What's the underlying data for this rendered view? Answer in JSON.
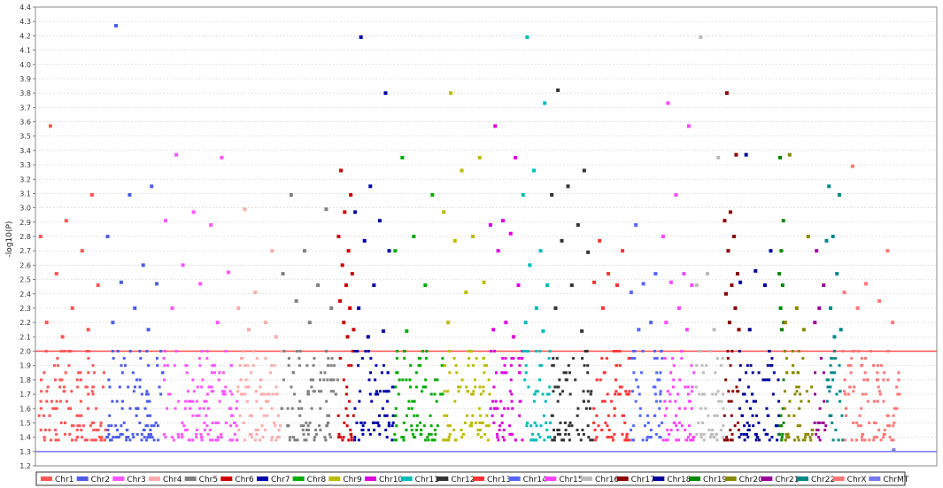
{
  "chart_data": {
    "type": "scatter",
    "title": "",
    "xlabel": "",
    "ylabel": "-log10(P)",
    "ylim": [
      1.2,
      4.4
    ],
    "yticks": [
      1.2,
      1.3,
      1.4,
      1.5,
      1.6,
      1.7,
      1.8,
      1.9,
      2.0,
      2.1,
      2.2,
      2.3,
      2.4,
      2.5,
      2.6,
      2.7,
      2.8,
      2.9,
      3.0,
      3.1,
      3.2,
      3.3,
      3.4,
      3.5,
      3.6,
      3.7,
      3.8,
      3.9,
      4.0,
      4.1,
      4.2,
      4.3,
      4.4
    ],
    "grid": true,
    "legend_position": "bottom",
    "threshold_lines": [
      {
        "value": 2.0,
        "color": "#ff4c4c"
      },
      {
        "value": 1.3,
        "color": "#6a6aff"
      }
    ],
    "series": [
      {
        "name": "Chr1",
        "color": "#ff5555",
        "top": [
          3.57,
          3.09,
          2.91,
          2.8,
          2.7,
          2.54,
          2.46,
          2.3,
          2.2,
          2.15,
          2.1
        ]
      },
      {
        "name": "Chr2",
        "color": "#4c5ce6",
        "top": [
          4.27,
          3.15,
          3.09,
          2.8,
          2.6,
          2.48,
          2.47,
          2.3,
          2.2,
          2.15
        ]
      },
      {
        "name": "Chr3",
        "color": "#ff55ff",
        "top": [
          3.37,
          3.35,
          2.97,
          2.91,
          2.88,
          2.6,
          2.55,
          2.47,
          2.3,
          2.2
        ]
      },
      {
        "name": "Chr4",
        "color": "#ffaaaa",
        "top": [
          2.99,
          2.7,
          2.41,
          2.3,
          2.2,
          2.15,
          2.1
        ]
      },
      {
        "name": "Chr5",
        "color": "#808080",
        "top": [
          3.09,
          2.99,
          2.7,
          2.54,
          2.46,
          2.35,
          2.3,
          2.2
        ]
      },
      {
        "name": "Chr6",
        "color": "#cc0000",
        "top": [
          3.26,
          3.09,
          2.97,
          2.8,
          2.7,
          2.6,
          2.54,
          2.46,
          2.35,
          2.3,
          2.2,
          2.15,
          2.1
        ]
      },
      {
        "name": "Chr7",
        "color": "#0000aa",
        "top": [
          4.19,
          3.8,
          3.15,
          2.97,
          2.91,
          2.77,
          2.7,
          2.46,
          2.3,
          2.14,
          2.1
        ]
      },
      {
        "name": "Chr8",
        "color": "#00aa00",
        "top": [
          3.35,
          3.09,
          2.8,
          2.7,
          2.46,
          2.14
        ]
      },
      {
        "name": "Chr9",
        "color": "#bbbb00",
        "top": [
          3.8,
          3.35,
          3.26,
          2.97,
          2.8,
          2.77,
          2.48,
          2.41,
          2.2
        ]
      },
      {
        "name": "Chr10",
        "color": "#dd00dd",
        "top": [
          3.57,
          3.35,
          2.91,
          2.88,
          2.82,
          2.7,
          2.46,
          2.2,
          2.15,
          2.1
        ]
      },
      {
        "name": "Chr11",
        "color": "#00bbbb",
        "top": [
          4.19,
          3.73,
          3.26,
          3.09,
          2.7,
          2.6,
          2.46,
          2.3,
          2.2,
          2.14
        ]
      },
      {
        "name": "Chr12",
        "color": "#333333",
        "top": [
          3.82,
          3.26,
          3.15,
          3.09,
          2.88,
          2.77,
          2.69,
          2.46,
          2.3,
          2.14
        ]
      },
      {
        "name": "Chr13",
        "color": "#ff3333",
        "top": [
          2.77,
          2.7,
          2.54,
          2.48,
          2.46,
          2.3
        ]
      },
      {
        "name": "Chr14",
        "color": "#5566ff",
        "top": [
          2.88,
          2.54,
          2.47,
          2.41,
          2.2,
          2.15
        ]
      },
      {
        "name": "Chr15",
        "color": "#ff44ff",
        "top": [
          3.73,
          3.57,
          3.09,
          2.8,
          2.54,
          2.48,
          2.46,
          2.3,
          2.2,
          2.15
        ]
      },
      {
        "name": "Chr16",
        "color": "#bbbbbb",
        "top": [
          4.19,
          3.35,
          2.54,
          2.46,
          2.15
        ]
      },
      {
        "name": "Chr17",
        "color": "#880000",
        "top": [
          3.8,
          3.37,
          2.97,
          2.91,
          2.8,
          2.7,
          2.54,
          2.46,
          2.4,
          2.3,
          2.2,
          2.15
        ]
      },
      {
        "name": "Chr18",
        "color": "#000099",
        "top": [
          3.37,
          2.7,
          2.56,
          2.48,
          2.46,
          2.15
        ]
      },
      {
        "name": "Chr19",
        "color": "#008800",
        "top": [
          3.35,
          2.91,
          2.7,
          2.54,
          2.46,
          2.3,
          2.2,
          2.15
        ]
      },
      {
        "name": "Chr20",
        "color": "#888800",
        "top": [
          3.37,
          2.8,
          2.3,
          2.2,
          2.15
        ]
      },
      {
        "name": "Chr21",
        "color": "#990099",
        "top": [
          2.7,
          2.46,
          2.3,
          2.2
        ]
      },
      {
        "name": "Chr22",
        "color": "#008888",
        "top": [
          3.15,
          3.09,
          2.8,
          2.77,
          2.54,
          2.3,
          2.15,
          2.1
        ]
      },
      {
        "name": "ChrX",
        "color": "#ff7777",
        "top": [
          3.29,
          2.7,
          2.47,
          2.41,
          2.35,
          2.3,
          2.2
        ]
      },
      {
        "name": "ChrMT",
        "color": "#7777ee",
        "top": [
          1.31
        ]
      }
    ]
  }
}
